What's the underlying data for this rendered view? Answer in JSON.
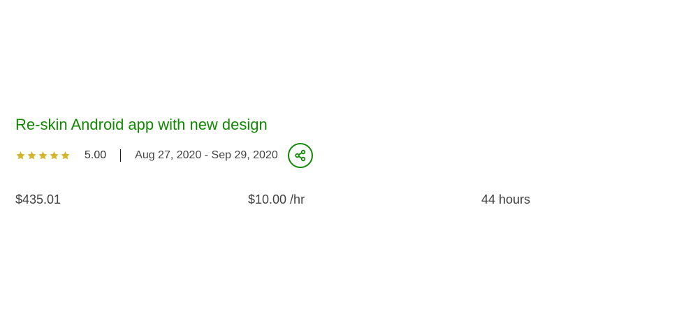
{
  "job": {
    "title": "Re-skin Android app with new design",
    "rating": {
      "stars": 5,
      "max_stars": 5,
      "value": "5.00",
      "star_color": "#d4b52b"
    },
    "date_range": "Aug 27, 2020 - Sep 29, 2020",
    "share_icon": "share-icon",
    "stats": {
      "total_earned": "$435.01",
      "hourly_rate": "$10.00 /hr",
      "hours": "44 hours"
    }
  },
  "colors": {
    "accent": "#108a00",
    "text": "#444444"
  }
}
